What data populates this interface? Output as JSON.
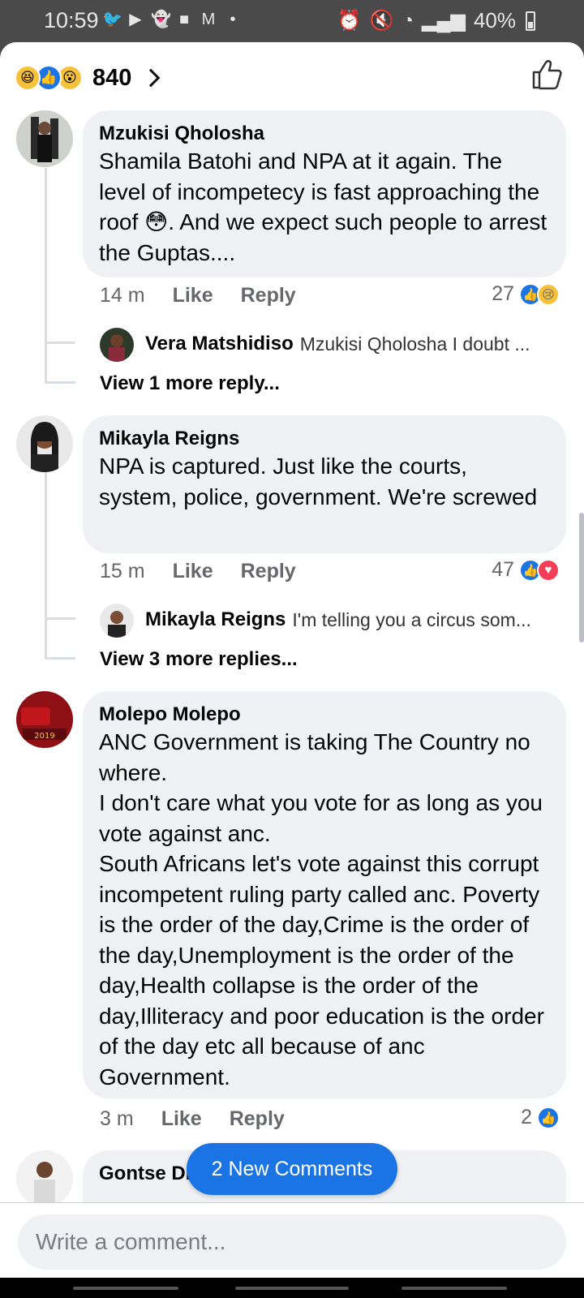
{
  "status_bar": {
    "time": "10:59",
    "battery": "40%",
    "app_icons": [
      "twitter-icon",
      "youtube-icon",
      "snapchat-icon",
      "messages-icon",
      "gmail-icon",
      "dot-icon"
    ]
  },
  "reactions_header": {
    "count": "840",
    "reactions": [
      "haha",
      "like",
      "wow"
    ]
  },
  "comments": [
    {
      "author": "Mzukisi Qholosha",
      "text": "Shamila Batohi and NPA at it again. The level of incompetecy is fast approaching the roof 😳. And we expect such people to arrest the Guptas....",
      "time": "14 m",
      "like_label": "Like",
      "reply_label": "Reply",
      "reaction_count": "27",
      "reply_preview": {
        "author": "Vera Matshidiso",
        "text": "Mzukisi Qholosha I doubt ..."
      },
      "view_more": "View 1 more reply..."
    },
    {
      "author": "Mikayla Reigns",
      "text": "NPA is captured. Just like the courts, system, police, government. We're screwed",
      "time": "15 m",
      "like_label": "Like",
      "reply_label": "Reply",
      "reaction_count": "47",
      "reply_preview": {
        "author": "Mikayla Reigns",
        "text": "I'm telling you a circus som..."
      },
      "view_more": "View 3 more replies..."
    },
    {
      "author": "Molepo Molepo",
      "text": "ANC Government is taking The Country no where.\nI don't care what you vote for as long as you vote against anc.\nSouth Africans let's vote against this corrupt incompetent ruling party called anc. Poverty is the order of the day,Crime is the order of the day,Unemployment is the order of the day,Health collapse is the order of the day,Illiteracy and poor education is the order of the day etc all because of anc Government.",
      "time": "3 m",
      "like_label": "Like",
      "reply_label": "Reply",
      "reaction_count": "2"
    },
    {
      "author": "Gontse Ditshego"
    }
  ],
  "new_comments_label": "2 New Comments",
  "composer": {
    "placeholder": "Write a comment..."
  },
  "colors": {
    "accent": "#1b74e4",
    "bubble": "#eff1f4",
    "muted_text": "#65676b"
  }
}
